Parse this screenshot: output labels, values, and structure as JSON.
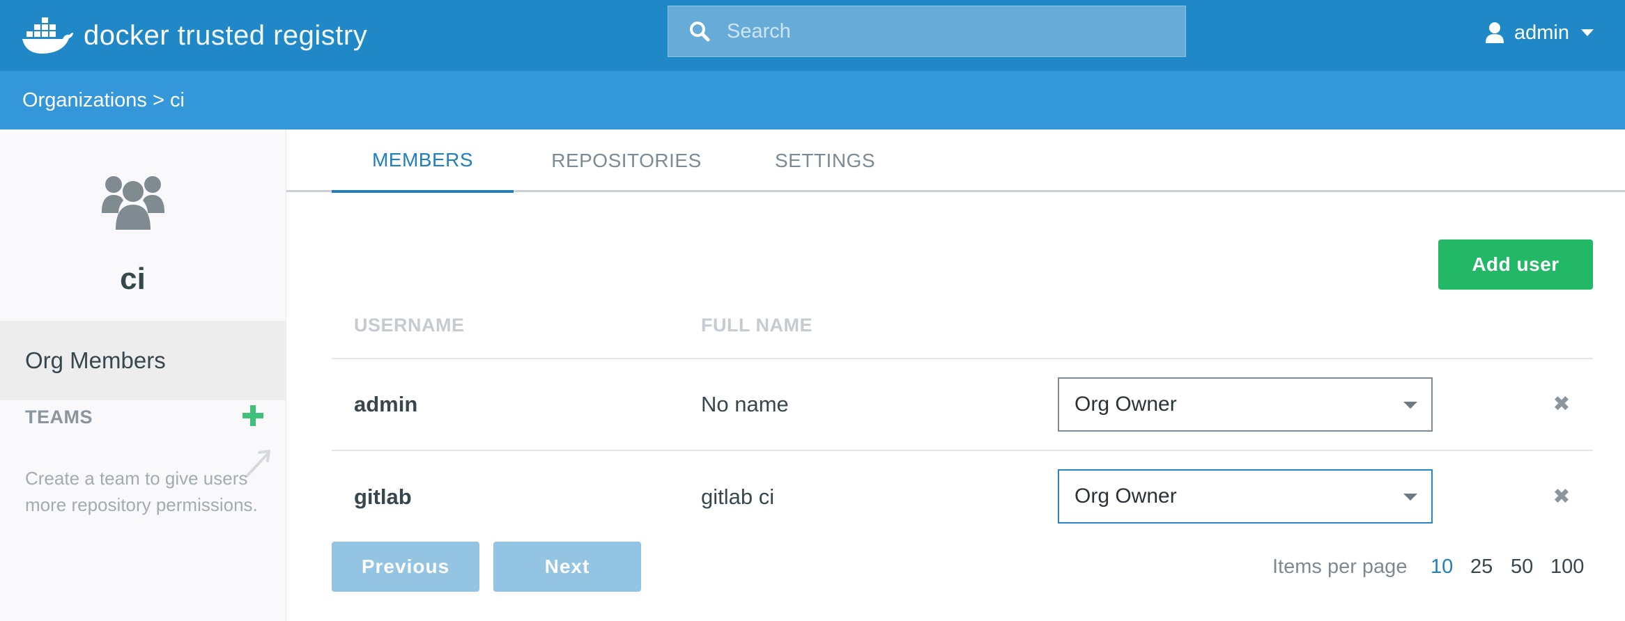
{
  "header": {
    "logo_bold": "docker",
    "logo_light": "trusted registry",
    "search_placeholder": "Search",
    "user": "admin"
  },
  "breadcrumb": "Organizations > ci",
  "sidebar": {
    "org_name": "ci",
    "members_label": "Org Members",
    "teams_label": "TEAMS",
    "teams_hint": "Create a team to give users more repository permissions."
  },
  "tabs": [
    {
      "label": "MEMBERS",
      "active": true
    },
    {
      "label": "REPOSITORIES",
      "active": false
    },
    {
      "label": "SETTINGS",
      "active": false
    }
  ],
  "add_user_label": "Add user",
  "table": {
    "headers": [
      "USERNAME",
      "FULL NAME"
    ],
    "rows": [
      {
        "username": "admin",
        "full_name": "No name",
        "role": "Org Owner"
      },
      {
        "username": "gitlab",
        "full_name": "gitlab ci",
        "role": "Org Owner"
      }
    ]
  },
  "pagination": {
    "previous_label": "Previous",
    "next_label": "Next",
    "items_per_page_label": "Items per page",
    "options": [
      "10",
      "25",
      "50",
      "100"
    ],
    "selected": "10"
  },
  "colors": {
    "topbar": "#2188c8",
    "breadcrumb_bar": "#3397da",
    "accent": "#1f7fbf",
    "add_button": "#23b865",
    "disabled_button": "#93c4e2"
  }
}
